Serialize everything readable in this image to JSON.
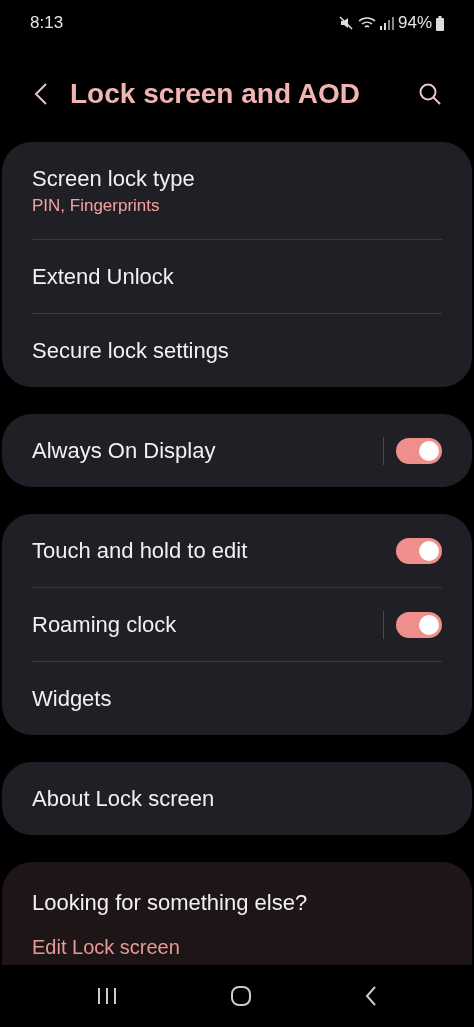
{
  "status_bar": {
    "time": "8:13",
    "battery": "94%"
  },
  "header": {
    "title": "Lock screen and AOD"
  },
  "groups": [
    {
      "items": [
        {
          "kind": "link",
          "label": "Screen lock type",
          "summary": "PIN, Fingerprints"
        },
        {
          "kind": "link",
          "label": "Extend Unlock"
        },
        {
          "kind": "link",
          "label": "Secure lock settings"
        }
      ]
    },
    {
      "items": [
        {
          "kind": "switch",
          "label": "Always On Display",
          "on": true,
          "split": true
        }
      ]
    },
    {
      "items": [
        {
          "kind": "switch",
          "label": "Touch and hold to edit",
          "on": true,
          "split": false
        },
        {
          "kind": "switch",
          "label": "Roaming clock",
          "on": true,
          "split": true
        },
        {
          "kind": "link",
          "label": "Widgets"
        }
      ]
    },
    {
      "items": [
        {
          "kind": "link",
          "label": "About Lock screen"
        }
      ]
    }
  ],
  "suggestions": {
    "title": "Looking for something else?",
    "links": [
      "Edit Lock screen"
    ]
  }
}
